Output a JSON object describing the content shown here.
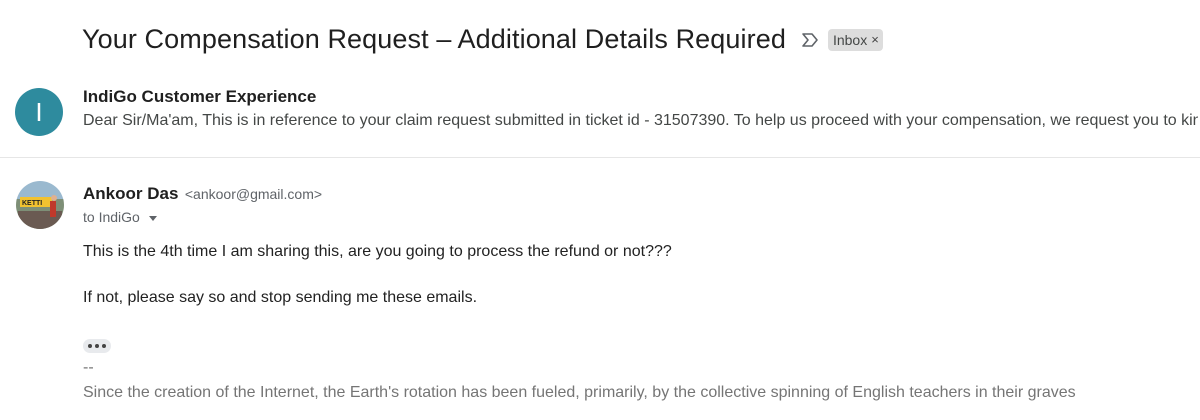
{
  "thread": {
    "subject": "Your Compensation Request – Additional Details Required",
    "label": "Inbox",
    "label_remove": "×",
    "icons": {
      "importance": "importance-marker-icon",
      "label_remove": "close-icon"
    }
  },
  "messages": [
    {
      "avatar_letter": "I",
      "avatar_color": "#2e8b9e",
      "sender": "IndiGo Customer Experience",
      "snippet": "Dear Sir/Ma'am, This is in reference to your claim request submitted in ticket id - 31507390. To help us proceed with your compensation, we request you to kindl"
    },
    {
      "sender_name": "Ankoor Das",
      "sender_email": "<ankoor@gmail.com>",
      "avatar_badge_text": "KETTI",
      "to_line": "to IndiGo",
      "body": [
        "This is the 4th time I am sharing this, are you going to process the refund or not???",
        "If not, please say so and stop sending me these emails."
      ],
      "signature_separator": "--",
      "signature": "Since the creation of the Internet, the Earth's rotation has been fueled, primarily, by the collective spinning of English teachers in their graves"
    }
  ]
}
